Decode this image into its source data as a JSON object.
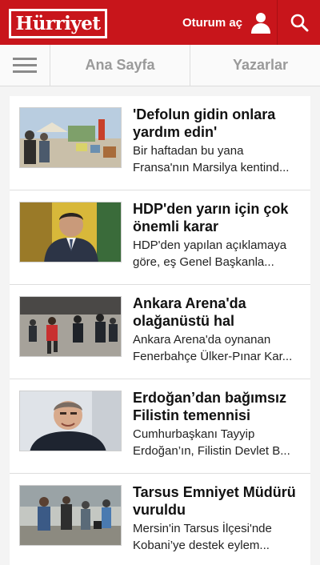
{
  "header": {
    "logo_text": "Hürriyet",
    "login_label": "Oturum aç",
    "icons": {
      "user": "user-icon",
      "search": "search-icon",
      "menu": "hamburger-menu-icon"
    },
    "colors": {
      "brand": "#c8151b"
    }
  },
  "tabs": [
    {
      "label": "Ana Sayfa"
    },
    {
      "label": "Yazarlar"
    }
  ],
  "news": [
    {
      "headline": "'Defolun gidin onlara yardım edin'",
      "summary_line1": "Bir haftadan bu yana",
      "summary_line2": "Fransa'nın Marsilya kentind..."
    },
    {
      "headline": "HDP'den yarın için çok önemli karar",
      "summary_line1": "HDP'den yapılan açıklamaya",
      "summary_line2": "göre, eş Genel Başkanla..."
    },
    {
      "headline": "Ankara Arena'da olağanüstü hal",
      "summary_line1": "Ankara Arena'da oynanan",
      "summary_line2": "Fenerbahçe Ülker-Pınar Kar..."
    },
    {
      "headline": "Erdoğan’dan bağımsız Filistin temennisi",
      "summary_line1": "Cumhurbaşkanı Tayyip",
      "summary_line2": "Erdoğan’ın, Filistin Devlet B..."
    },
    {
      "headline": "Tarsus Emniyet Müdürü vuruldu",
      "summary_line1": "Mersin'in Tarsus İlçesi'nde",
      "summary_line2": "Kobani’ye destek eylem..."
    }
  ]
}
